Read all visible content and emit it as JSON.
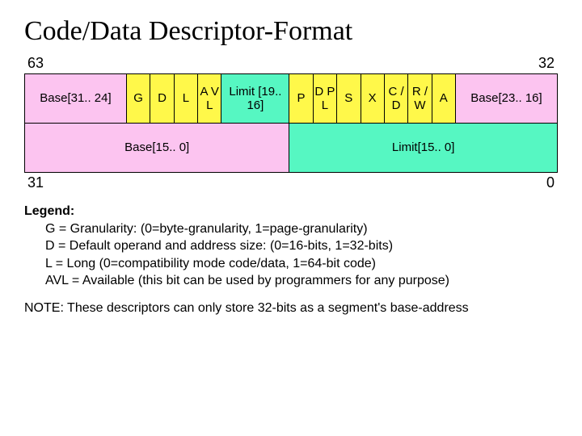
{
  "title": "Code/Data Descriptor-Format",
  "bits": {
    "hi_left": "63",
    "hi_right": "32",
    "lo_left": "31",
    "lo_right": "0"
  },
  "row1": {
    "base_hi": "Base[31.. 24]",
    "g": "G",
    "d": "D",
    "l": "L",
    "avl": "A\nV\nL",
    "limit_hi": "Limit\n[19.. 16]",
    "p": "P",
    "dpl": "D\nP\nL",
    "s": "S",
    "x": "X",
    "cd": "C\n/\nD",
    "rw": "R\n/\nW",
    "a": "A",
    "base_mid": "Base[23.. 16]"
  },
  "row2": {
    "base_lo": "Base[15.. 0]",
    "limit_lo": "Limit[15.. 0]"
  },
  "legend": {
    "heading": "Legend:",
    "g": "G = Granularity: (0=byte-granularity, 1=page-granularity)",
    "d": "D = Default operand and address size: (0=16-bits, 1=32-bits)",
    "l": "L = Long (0=compatibility mode code/data, 1=64-bit code)",
    "avl": "AVL = Available (this bit can be used by programmers for any purpose)"
  },
  "note": "NOTE: These descriptors can only store 32-bits as a segment's base-address"
}
